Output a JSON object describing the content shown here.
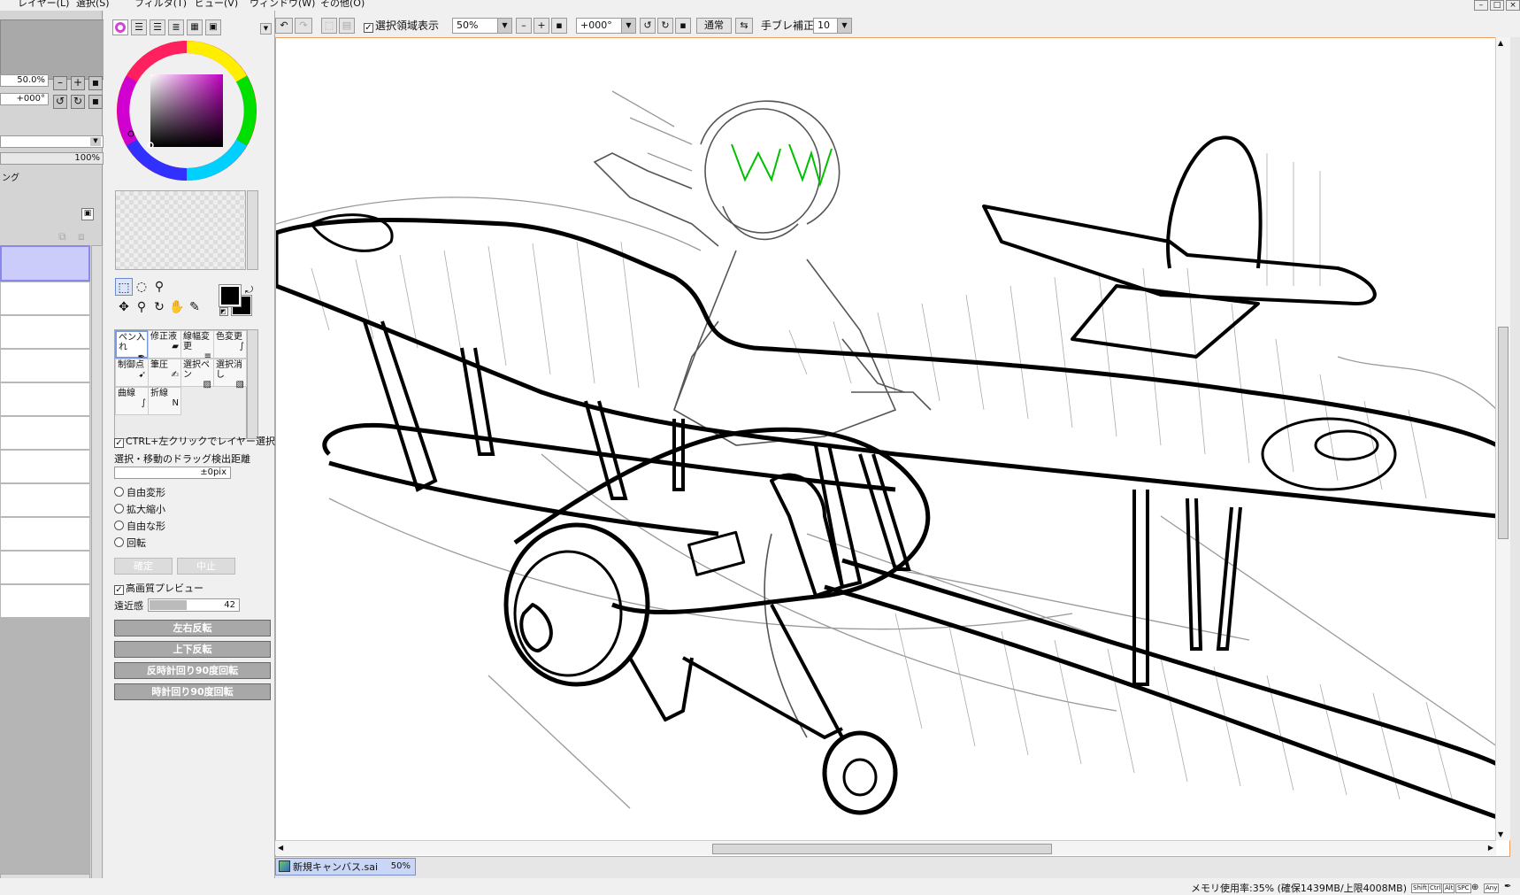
{
  "menu": [
    "レイヤー(L)",
    "選択(S)",
    "フィルタ(T)",
    "ビュー(V)",
    "ウィンドウ(W)",
    "その他(O)"
  ],
  "window_buttons": [
    "–",
    "□",
    "×"
  ],
  "navigator": {
    "zoom": "50.0%",
    "angle": "+000°"
  },
  "layer_panel": {
    "opacity": "100%",
    "mode_text": "ング"
  },
  "toolbar": {
    "show_selection_label": "選択領域表示",
    "zoom": "50%",
    "angle": "+000°",
    "blend_mode": "通常",
    "stabilizer_label": "手ブレ補正",
    "stabilizer_value": "10"
  },
  "tools": {
    "brushes": [
      {
        "name": "ペン入れ",
        "icon": "pen-icon"
      },
      {
        "name": "修正液",
        "icon": "eraser-icon"
      },
      {
        "name": "線幅変更",
        "icon": "line-width-icon"
      },
      {
        "name": "色変更",
        "icon": "color-change-icon"
      },
      {
        "name": "制御点",
        "icon": "control-point-icon"
      },
      {
        "name": "筆圧",
        "icon": "pressure-icon"
      },
      {
        "name": "選択ペン",
        "icon": "selection-pen-icon"
      },
      {
        "name": "選択消し",
        "icon": "selection-erase-icon"
      },
      {
        "name": "曲線",
        "icon": "curve-icon"
      },
      {
        "name": "折線",
        "icon": "polyline-icon"
      }
    ],
    "ctrl_click_label": "CTRL+左クリックでレイヤー選択",
    "drag_threshold_label": "選択・移動のドラッグ検出距離",
    "drag_threshold_value": "±0pix",
    "transform_options": [
      "自由変形",
      "拡大縮小",
      "自由な形",
      "回転"
    ],
    "confirm_label": "確定",
    "cancel_label": "中止",
    "hq_preview_label": "高画質プレビュー",
    "perspective_label": "遠近感",
    "perspective_value": "42",
    "perspective_level": 0.42,
    "flip_h_label": "左右反転",
    "flip_v_label": "上下反転",
    "rotate_ccw_label": "反時計回り90度回転",
    "rotate_cw_label": "時計回り90度回転"
  },
  "document_tab": {
    "name": "新規キャンバス.sai",
    "zoom": "50%"
  },
  "status": {
    "memory": "メモリ使用率:35% (確保1439MB/上限4008MB)",
    "keys": [
      "Shift",
      "Ctrl",
      "Alt",
      "SPC",
      "Any"
    ]
  },
  "colors": {
    "accent": "#c9d6f5",
    "canvas_border": "#f0a060",
    "primary": "#000000"
  }
}
